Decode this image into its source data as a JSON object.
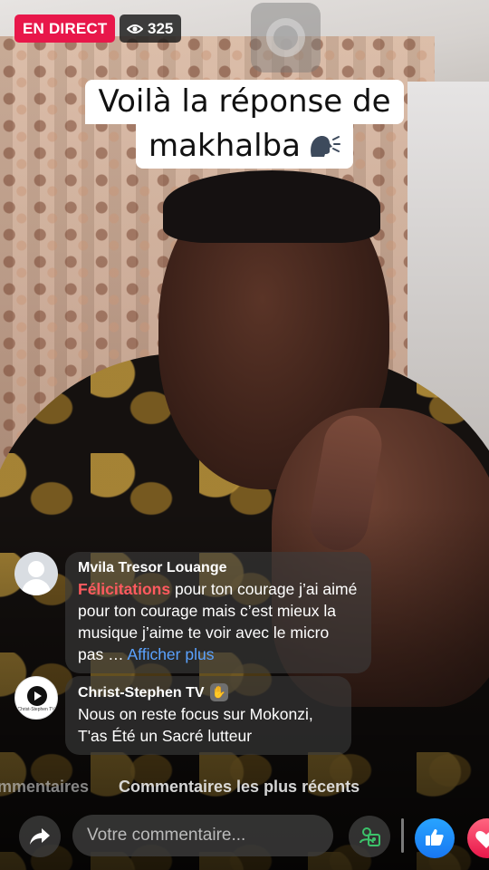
{
  "stream": {
    "live_label": "EN DIRECT",
    "viewer_count": "325",
    "caption_line1": "Voilà la réponse de",
    "caption_line2": "makhalba",
    "caption_emoji_icon": "speaking-head-icon"
  },
  "comments": [
    {
      "author": "Mvila Tresor Louange",
      "avatar_icon": "default-avatar-icon",
      "highlight": "Félicitations",
      "text": " pour ton courage j’ai aimé pour ton courage mais c’est mieux la musique j’aime te voir avec le micro pas  … ",
      "more_label": "Afficher plus"
    },
    {
      "author": "Christ-Stephen TV",
      "author_badge_icon": "waving-hand-icon",
      "avatar_icon": "christ-stephen-tv-logo",
      "avatar_logo_text": "Christ-Stephen TV",
      "text": "Nous on reste focus sur Mokonzi, T'as Été un Sacré lutteur"
    }
  ],
  "tabs": {
    "previous": "mmentaires",
    "current": "Commentaires les plus récents"
  },
  "composer": {
    "placeholder": "Votre commentaire..."
  },
  "colors": {
    "live_badge": "#e8174a",
    "highlight": "#ff5a5f",
    "link": "#5aa2ff",
    "like": "#1877f2"
  }
}
